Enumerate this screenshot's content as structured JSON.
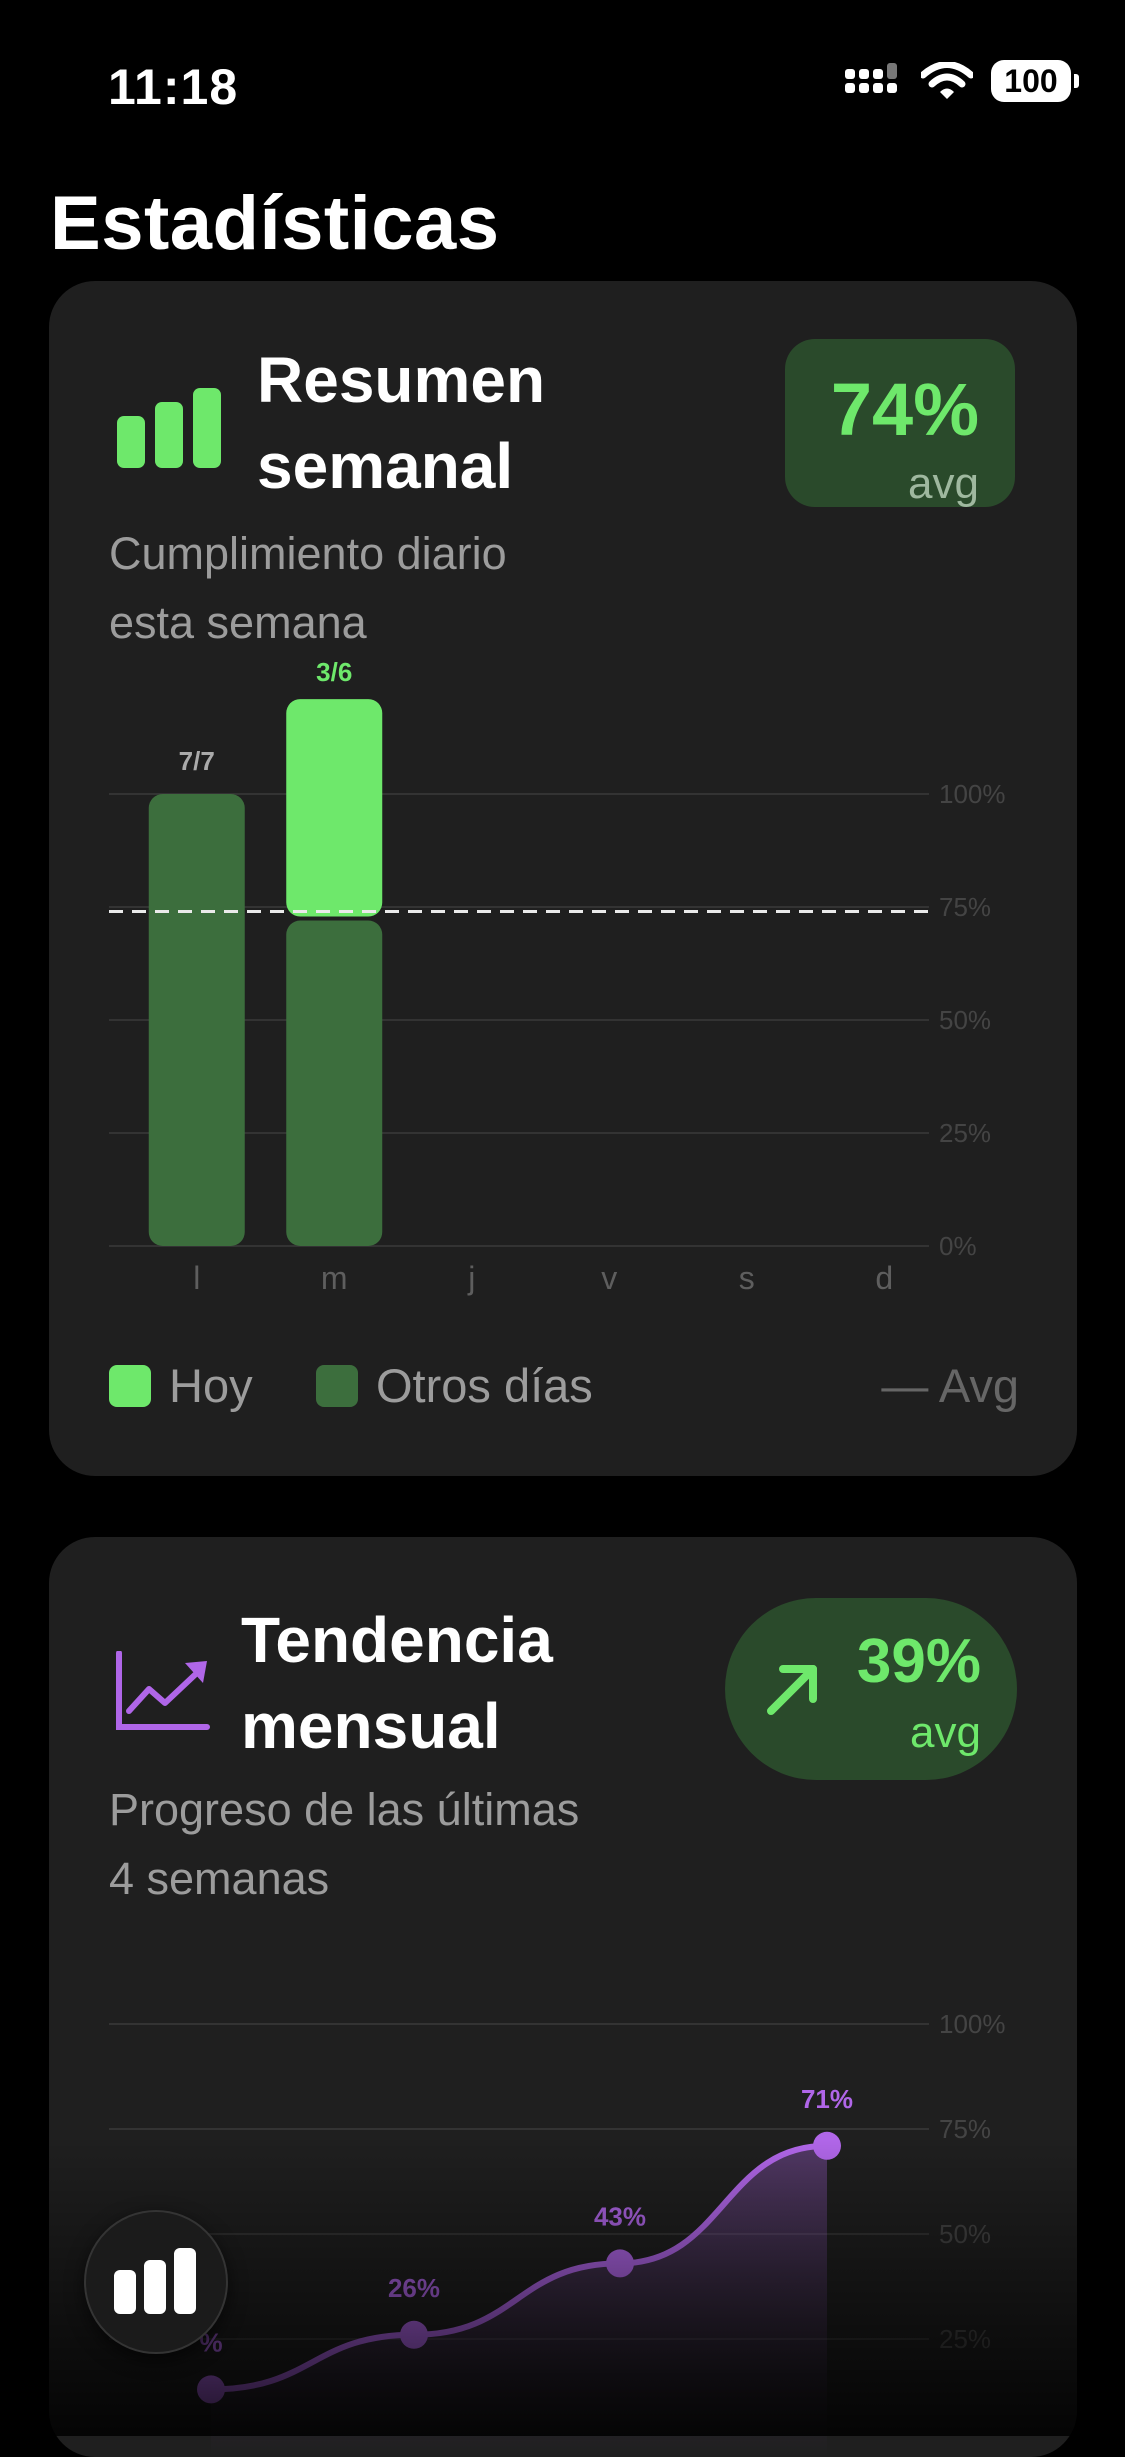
{
  "status_bar": {
    "time": "11:18",
    "battery": "100"
  },
  "page": {
    "title": "Estadísticas"
  },
  "weekly": {
    "title_line1": "Resumen",
    "title_line2": "semanal",
    "subtitle_line1": "Cumplimiento diario",
    "subtitle_line2": "esta semana",
    "avg_value": "74%",
    "avg_label": "avg",
    "legend": {
      "today": "Hoy",
      "other": "Otros días",
      "avg": "— Avg"
    },
    "colors": {
      "today": "#6ee86b",
      "other": "#3c6e3d",
      "accent": "#6ee86b"
    }
  },
  "monthly": {
    "title_line1": "Tendencia",
    "title_line2": "mensual",
    "subtitle_line1": "Progreso de las últimas",
    "subtitle_line2": "4 semanas",
    "avg_value": "39%",
    "avg_label": "avg",
    "trend_icon": "arrow-up-right-icon",
    "colors": {
      "line": "#b066e8",
      "accent": "#6ee86b"
    }
  },
  "chart_data": [
    {
      "type": "bar",
      "categories": [
        "l",
        "m",
        "j",
        "v",
        "s",
        "d"
      ],
      "values": [
        100,
        121,
        null,
        null,
        null,
        null
      ],
      "stack_split": {
        "m": {
          "other_days": 72,
          "today": 49
        }
      },
      "data_labels": [
        "7/7",
        "3/6",
        "",
        "",
        "",
        ""
      ],
      "y_ticks": [
        "100%",
        "75%",
        "50%",
        "25%",
        "0%"
      ],
      "ylim": [
        0,
        100
      ],
      "average_line": 74,
      "legend": [
        "Hoy",
        "Otros días",
        "— Avg"
      ],
      "grid": true,
      "legend_placement": "bottom"
    },
    {
      "type": "line",
      "x": [
        1,
        2,
        3,
        4
      ],
      "values": [
        13,
        26,
        43,
        71
      ],
      "data_labels": [
        "%",
        "26%",
        "43%",
        "71%"
      ],
      "y_ticks": [
        "100%",
        "75%",
        "50%",
        "25%"
      ],
      "ylim": [
        0,
        100
      ],
      "grid": true,
      "area_fill": true
    }
  ]
}
